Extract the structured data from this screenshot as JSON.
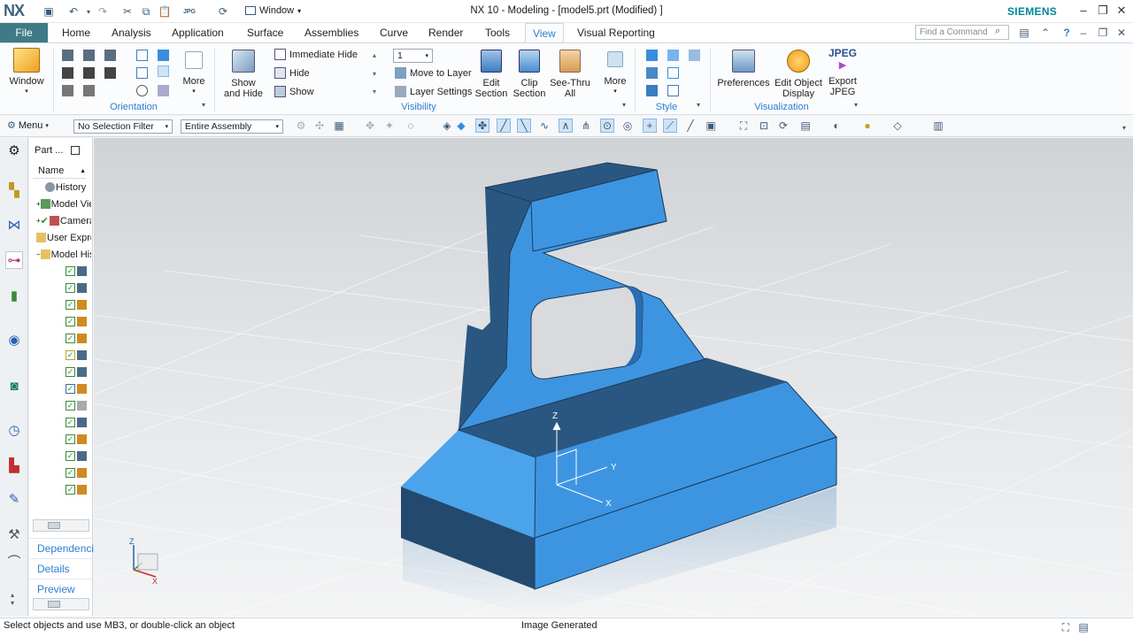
{
  "app": {
    "logo": "NX",
    "title": "NX 10 - Modeling - [model5.prt (Modified) ]",
    "brand": "SIEMENS",
    "window_menu": "Window"
  },
  "colors": {
    "accent": "#2b7fd0",
    "file_tab": "#3f7b86",
    "model_light": "#3d95e1",
    "model_dark": "#234a6e",
    "brand": "#00879c"
  },
  "tabs": [
    "File",
    "Home",
    "Analysis",
    "Application",
    "Surface",
    "Assemblies",
    "Curve",
    "Render",
    "Tools",
    "View",
    "Visual Reporting"
  ],
  "active_tab": "View",
  "search": {
    "placeholder": "Find a Command"
  },
  "ribbon": {
    "window_label": "Window",
    "orientation": {
      "group": "Orientation",
      "more": "More"
    },
    "showhide": {
      "show_and_hide": "Show\nand Hide",
      "immediate_hide": "Immediate Hide",
      "hide": "Hide",
      "show": "Show"
    },
    "visibility": {
      "group": "Visibility",
      "layer_value": "1",
      "move_to_layer": "Move to Layer",
      "layer_settings": "Layer Settings",
      "edit_section": "Edit\nSection",
      "clip_section": "Clip\nSection",
      "see_thru_all": "See-Thru\nAll",
      "more": "More"
    },
    "style": {
      "group": "Style"
    },
    "visualization": {
      "group": "Visualization",
      "preferences": "Preferences",
      "edit_object_display": "Edit Object\nDisplay",
      "export_jpeg": "Export\nJPEG",
      "jpeg_badge": "JPEG"
    }
  },
  "toolbar": {
    "menu": "Menu",
    "selection_filter": "No Selection Filter",
    "scope": "Entire Assembly"
  },
  "navigator": {
    "header": "Part ...",
    "column": "Name",
    "rows": [
      "History",
      "Model Views",
      "Cameras",
      "User Expressions",
      "Model History"
    ],
    "panels": [
      "Dependencies",
      "Details",
      "Preview"
    ]
  },
  "triad": {
    "z": "Z",
    "y": "Y",
    "x": "X"
  },
  "status": {
    "left": "Select objects and use MB3, or double-click an object",
    "center": "Image Generated"
  }
}
